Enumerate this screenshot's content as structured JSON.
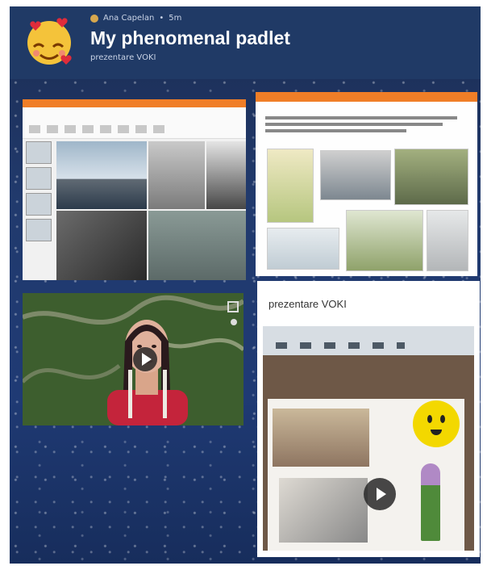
{
  "header": {
    "author": "Ana Capelan",
    "time": "5m",
    "title": "My phenomenal padlet",
    "subtitle": "prezentare VOKI"
  },
  "posts": [
    {
      "kind": "image",
      "description": "Presentation slide collage with historical photos"
    },
    {
      "kind": "image",
      "description": "Document slide with botanical illustrations and archive photos"
    },
    {
      "kind": "video",
      "description": "Animated avatar in a forest"
    },
    {
      "kind": "video",
      "title": "prezentare VOKI"
    }
  ],
  "icons": [
    "emoji-avatar-icon",
    "play-icon",
    "smiley-icon"
  ]
}
